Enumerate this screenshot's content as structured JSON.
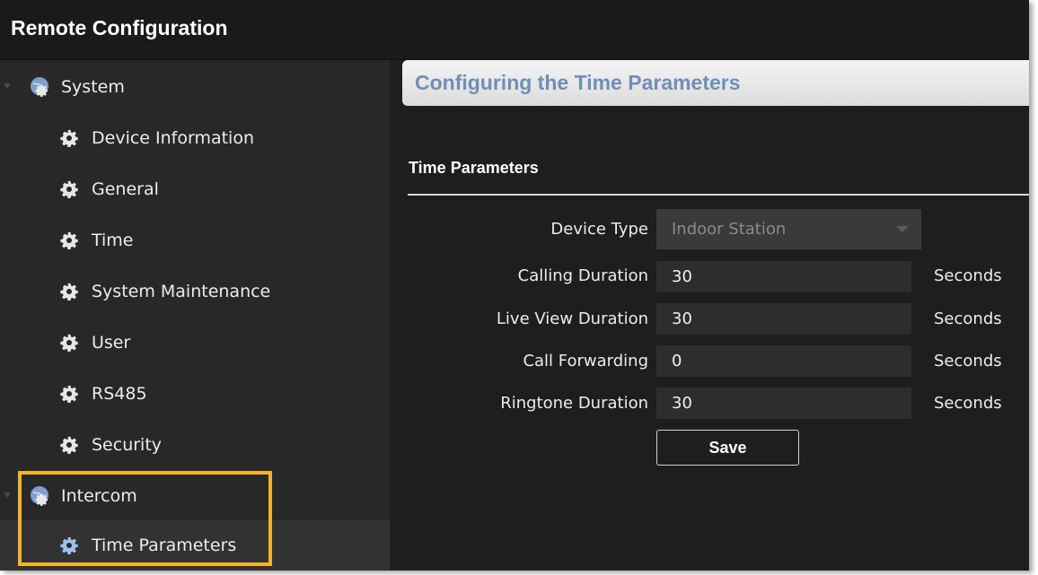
{
  "window": {
    "title": "Remote Configuration"
  },
  "sidebar": {
    "groups": [
      {
        "label": "System",
        "items": [
          {
            "label": "Device Information"
          },
          {
            "label": "General"
          },
          {
            "label": "Time"
          },
          {
            "label": "System Maintenance"
          },
          {
            "label": "User"
          },
          {
            "label": "RS485"
          },
          {
            "label": "Security"
          }
        ]
      },
      {
        "label": "Intercom",
        "items": [
          {
            "label": "Time Parameters",
            "selected": true
          }
        ]
      }
    ]
  },
  "main": {
    "header": "Configuring the Time Parameters",
    "section_title": "Time Parameters",
    "form": {
      "device_type": {
        "label": "Device Type",
        "value": "Indoor Station"
      },
      "calling_duration": {
        "label": "Calling Duration",
        "value": "30",
        "unit": "Seconds"
      },
      "live_view_duration": {
        "label": "Live View Duration",
        "value": "30",
        "unit": "Seconds"
      },
      "call_forwarding": {
        "label": "Call Forwarding",
        "value": "0",
        "unit": "Seconds"
      },
      "ringtone_duration": {
        "label": "Ringtone Duration",
        "value": "30",
        "unit": "Seconds"
      }
    },
    "save_label": "Save"
  },
  "colors": {
    "highlight": "#f2b329",
    "header_text": "#6f8fb8",
    "background": "#1e1e1e",
    "sidebar": "#282828"
  }
}
